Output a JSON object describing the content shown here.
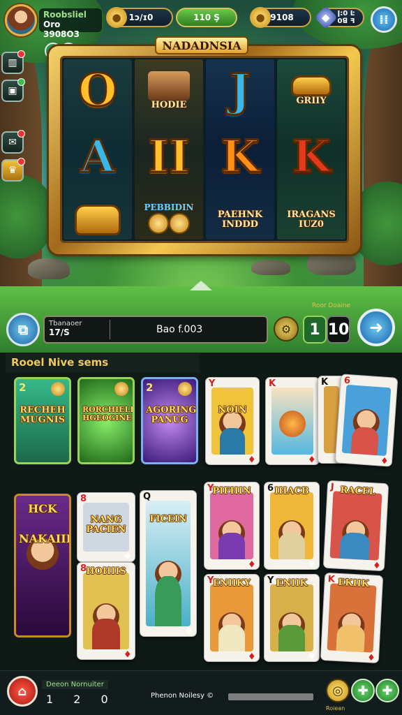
{
  "player": {
    "line1": "Roobsliel",
    "line2": "Oro 3908O3"
  },
  "resources": [
    {
      "icon": "gold-coin-icon",
      "value": "1ᴐ/ɪ0"
    },
    {
      "icon": "",
      "value": "110 Ş"
    },
    {
      "icon": "gold-coin-icon",
      "value": "9108"
    },
    {
      "icon": "gem-icon",
      "value": "ǀ:0 Ŀ\n0ꓭ ꟻ"
    }
  ],
  "slot": {
    "title": "NADADNSIA",
    "reels": [
      {
        "top": "O",
        "mid": "A",
        "bottom_label": ""
      },
      {
        "top_label": "HODIE",
        "mid": "II",
        "bottom_label": "PEBBIDIN"
      },
      {
        "top": "J",
        "mid": "K",
        "bottom_label": "PAEHNK\nINDDD"
      },
      {
        "top_label": "GRIIY",
        "mid": "K",
        "bottom_label": "IRAGANS\nIUZ0"
      }
    ]
  },
  "bet": {
    "small_label": "Tbanaoer",
    "small_value": "17/S",
    "main_value": "Bao f.003",
    "info": "Roor Doaine",
    "num1": "1",
    "num2": "10"
  },
  "collection": {
    "title": "Rooel Nive sems",
    "power_cards": [
      {
        "corner": "2",
        "caption": "RECHEH\nMUGNIS",
        "color": "#2a9a6a"
      },
      {
        "corner": "",
        "caption": "RORCHIELIS\nHGEOGINE",
        "color": "#1f8a2a"
      },
      {
        "corner": "2",
        "caption": "AGORING\nPANUG",
        "color": "#6a3ac0"
      }
    ],
    "play_cards_top": [
      {
        "corner": "Y",
        "suit": "♦",
        "caption": "NOIN",
        "color": "#f0c43a"
      },
      {
        "corner": "K",
        "suit": "♦",
        "caption": "",
        "color": "#55b8e0"
      },
      {
        "corner": "K",
        "suit": "♠",
        "caption": "",
        "color": "#d9a040"
      },
      {
        "corner": "6",
        "suit": "♦",
        "caption": "",
        "color": "#4aa0d8"
      }
    ],
    "play_cards_bottom": [
      {
        "corner": "",
        "suit": "",
        "caption": "HCK\n\nNAKAIIIG",
        "color": "#6a2a8a"
      },
      {
        "corner": "8",
        "suit": "♠",
        "caption": "NANG\nPACIEN",
        "color": "#cfd8e0"
      },
      {
        "corner": "8",
        "suit": "♦",
        "caption": "HOHIIS",
        "color": "#e0c050"
      },
      {
        "corner": "Q",
        "suit": "♠",
        "caption": "FICEIN",
        "color": "#b0dcea"
      },
      {
        "corner": "Y",
        "suit": "♦",
        "caption": "PIFHIN",
        "color": "#e06aa0"
      },
      {
        "corner": "6",
        "suit": "♠",
        "caption": "IHACB",
        "color": "#f0b83a"
      },
      {
        "corner": "J",
        "suit": "♦",
        "caption": "RACEL",
        "color": "#d8534a"
      },
      {
        "corner": "Y",
        "suit": "♦",
        "caption": "ENIIKY",
        "color": "#e89a3a"
      },
      {
        "corner": "Y",
        "suit": "♠",
        "caption": "ENIIK",
        "color": "#d8b04a"
      },
      {
        "corner": "K",
        "suit": "♦",
        "caption": "EKIIK",
        "color": "#d8723a"
      }
    ]
  },
  "bottom": {
    "label": "Deeon Nornuiter",
    "numbers": "1 2 0",
    "status": "Phenon Noilesy ©",
    "yellow_caption": "Roiean"
  }
}
